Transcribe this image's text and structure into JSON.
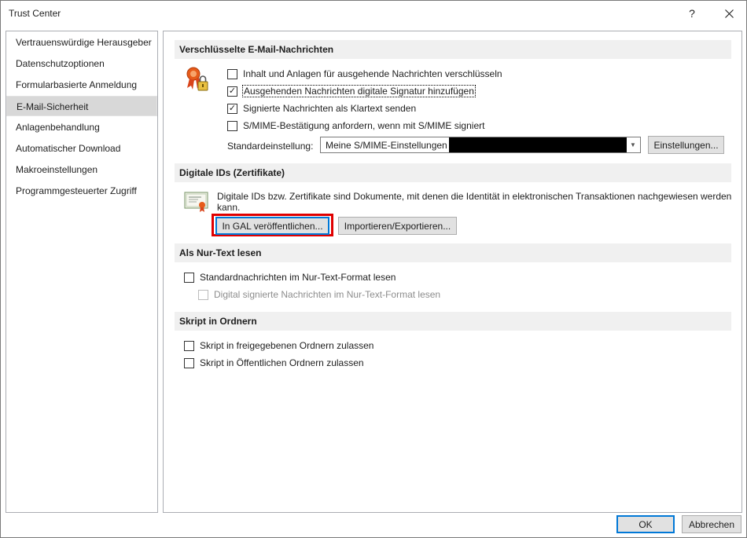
{
  "window": {
    "title": "Trust Center",
    "help_glyph": "?"
  },
  "nav": {
    "items": [
      {
        "label": "Vertrauenswürdige Herausgeber",
        "selected": false
      },
      {
        "label": "Datenschutzoptionen",
        "selected": false
      },
      {
        "label": "Formularbasierte Anmeldung",
        "selected": false
      },
      {
        "label": "E-Mail-Sicherheit",
        "selected": true
      },
      {
        "label": "Anlagenbehandlung",
        "selected": false
      },
      {
        "label": "Automatischer Download",
        "selected": false
      },
      {
        "label": "Makroeinstellungen",
        "selected": false
      },
      {
        "label": "Programmgesteuerter Zugriff",
        "selected": false
      }
    ]
  },
  "encrypted": {
    "header": "Verschlüsselte E-Mail-Nachrichten",
    "options": [
      {
        "label": "Inhalt und Anlagen für ausgehende Nachrichten verschlüsseln",
        "checked": false
      },
      {
        "label": "Ausgehenden Nachrichten digitale Signatur hinzufügen",
        "checked": true
      },
      {
        "label": "Signierte Nachrichten als Klartext senden",
        "checked": true
      },
      {
        "label": "S/MIME-Bestätigung anfordern, wenn mit S/MIME signiert",
        "checked": false
      }
    ],
    "default_label": "Standardeinstellung:",
    "default_value": "Meine S/MIME-Einstellungen",
    "settings_button": "Einstellungen..."
  },
  "digital_ids": {
    "header": "Digitale IDs (Zertifikate)",
    "description": "Digitale IDs bzw. Zertifikate sind Dokumente, mit denen die Identität in elektronischen Transaktionen nachgewiesen werden kann.",
    "publish_button": "In GAL veröffentlichen...",
    "import_button": "Importieren/Exportieren..."
  },
  "plain_text": {
    "header": "Als Nur-Text lesen",
    "options": [
      {
        "label": "Standardnachrichten im Nur-Text-Format lesen",
        "checked": false,
        "disabled": false
      },
      {
        "label": "Digital signierte Nachrichten im Nur-Text-Format lesen",
        "checked": false,
        "disabled": true
      }
    ]
  },
  "folder_script": {
    "header": "Skript in Ordnern",
    "options": [
      {
        "label": "Skript in freigegebenen Ordnern zulassen",
        "checked": false
      },
      {
        "label": "Skript in Öffentlichen Ordnern zulassen",
        "checked": false
      }
    ]
  },
  "footer": {
    "ok_button": "OK",
    "cancel_button": "Abbrechen"
  },
  "check_glyph": "✓",
  "colors": {
    "highlight": "#e00000",
    "section_bg": "#f0f0f0",
    "selected_nav": "#d8d8d8"
  }
}
